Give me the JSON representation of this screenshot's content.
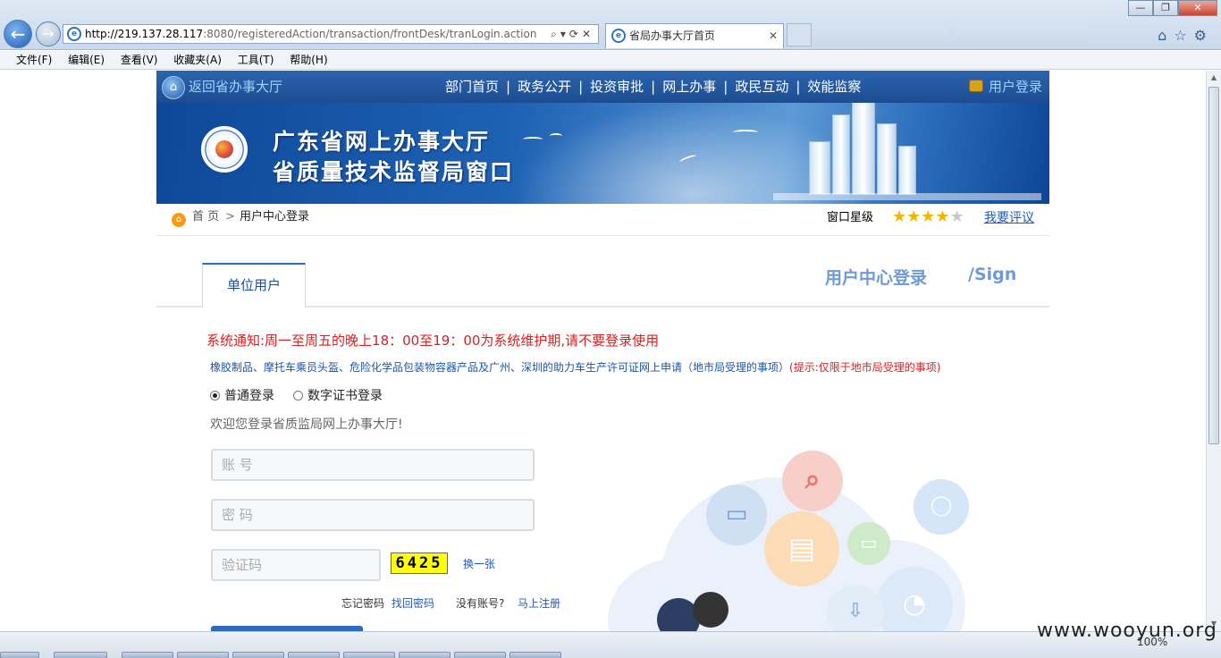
{
  "browser": {
    "address_host": "http://219.137.28.117",
    "address_rest": ":8080/registeredAction/transaction/frontDesk/tranLogin.action",
    "tab_title": "省局办事大厅首页",
    "zoom": "100%",
    "menu": [
      "文件(F)",
      "编辑(E)",
      "查看(V)",
      "收藏夹(A)",
      "工具(T)",
      "帮助(H)"
    ]
  },
  "topnav": {
    "home_link": "返回省办事大厅",
    "items": [
      "部门首页",
      "政务公开",
      "投资审批",
      "网上办事",
      "政民互动",
      "效能监察"
    ],
    "separator": "|",
    "login_link": "用户登录"
  },
  "banner": {
    "title_line1": "广东省网上办事大厅",
    "title_line2": "省质量技术监督局窗口"
  },
  "breadcrumb": {
    "home": "首 页",
    "separator": ">",
    "current": "用户中心登录",
    "rating_label": "窗口星级",
    "rating": 4,
    "rating_max": 5,
    "rate_link": "我要评议"
  },
  "login": {
    "tab_unit": "单位用户",
    "title": "用户中心登录",
    "title_sign": "/Sign",
    "notice": "系统通知:周一至周五的晚上18：00至19：00为系统维护期,请不要登录使用",
    "notice_sub": "橡胶制品、摩托车乘员头盔、危险化学品包装物容器产品及广州、深圳的助力车生产许可证网上申请（地市局受理的事项）",
    "notice_hint": "(提示:仅限于地市局受理的事项)",
    "radio_normal": "普通登录",
    "radio_cert": "数字证书登录",
    "welcome": "欢迎您登录省质监局网上办事大厅!",
    "account_placeholder": "账 号",
    "password_placeholder": "密 码",
    "captcha_placeholder": "验证码",
    "captcha_code": "6425",
    "captcha_refresh": "换一张",
    "forgot_label": "忘记密码",
    "forgot_link": "找回密码",
    "noacct_label": "没有账号?",
    "register_link": "马上注册"
  },
  "watermark": "www.wooyun.org",
  "colors": {
    "nav_blue": "#1c4d92",
    "accent_blue": "#2a6cc4",
    "notice_red": "#d42222",
    "star_gold": "#f5b400"
  }
}
